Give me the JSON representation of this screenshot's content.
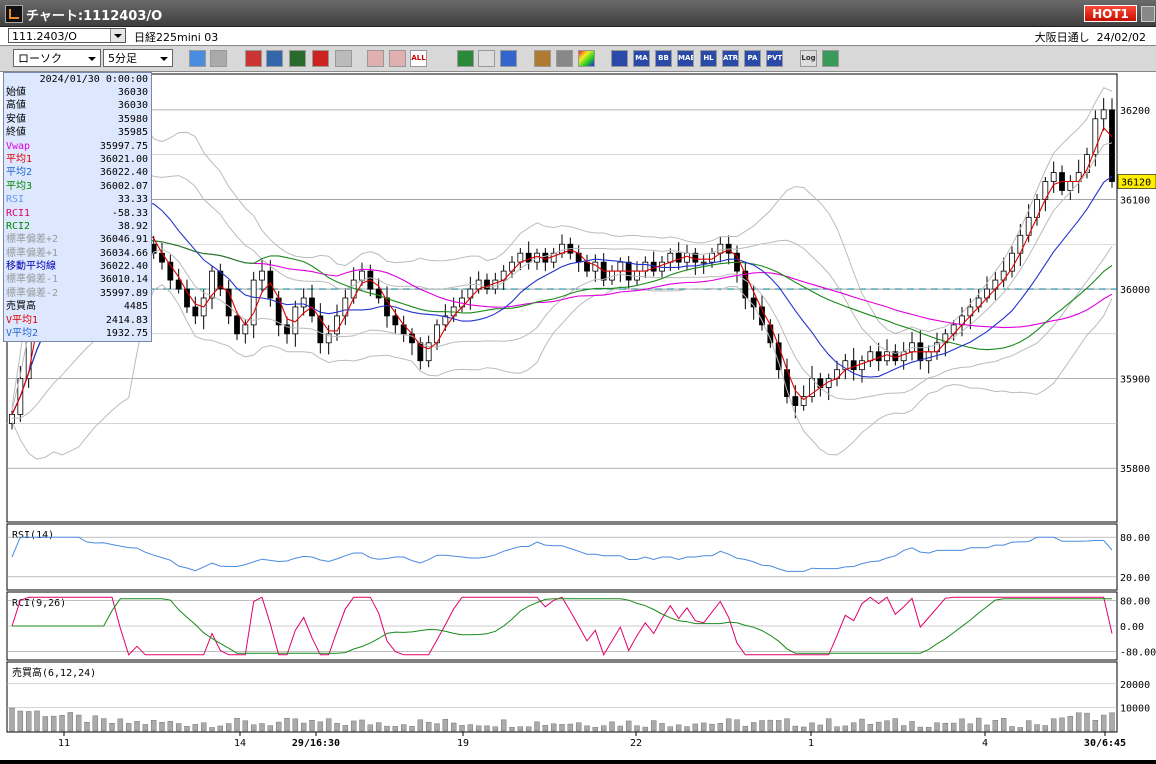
{
  "window": {
    "title": "チャート:1112403/O",
    "hot_label": "HOT1"
  },
  "info": {
    "code": "111.2403/O",
    "name": "日経225mini 03",
    "session": "大阪日通し",
    "date": "24/02/02"
  },
  "toolbar": {
    "chart_type": "ローソク",
    "period": "5分足",
    "icons": [
      "zoom-icon",
      "cursor-line-icon",
      "pointer-icon",
      "help-icon",
      "bar-icon",
      "compare-icon",
      "scale-icon",
      "line-draw-icon",
      "select-icon",
      "undo-icon",
      "grid-icon",
      "wrench-icon",
      "color-icon",
      "ma-icon",
      "bb-icon",
      "mae-icon",
      "hl-icon",
      "atr-icon",
      "para-icon",
      "pvt-icon",
      "log-icon",
      "bookmark-icon"
    ],
    "labels": {
      "ma": "MA",
      "bb": "BB",
      "mae": "MAE",
      "hl": "HL",
      "atr": "ATR",
      "para": "PA RA",
      "pvt": "PVT",
      "log": "Log",
      "all": "ALL"
    }
  },
  "data_panel": {
    "datetime": "2024/01/30 0:00:00",
    "rows": [
      {
        "k": "始値",
        "v": "36030",
        "color": "#000000"
      },
      {
        "k": "高値",
        "v": "36030",
        "color": "#000000"
      },
      {
        "k": "安値",
        "v": "35980",
        "color": "#000000"
      },
      {
        "k": "終値",
        "v": "35985",
        "color": "#000000"
      },
      {
        "k": "Vwap",
        "v": "35997.75",
        "color": "#e000e0"
      },
      {
        "k": "平均1",
        "v": "36021.00",
        "color": "#e00000"
      },
      {
        "k": "平均2",
        "v": "36022.40",
        "color": "#2266cc"
      },
      {
        "k": "平均3",
        "v": "36002.07",
        "color": "#008800"
      },
      {
        "k": "RSI",
        "v": "33.33",
        "color": "#6699ee"
      },
      {
        "k": "RCI1",
        "v": "-58.33",
        "color": "#e0006a"
      },
      {
        "k": "RCI2",
        "v": "38.92",
        "color": "#008800"
      },
      {
        "k": "標準偏差+2",
        "v": "36046.91",
        "color": "#999999"
      },
      {
        "k": "標準偏差+1",
        "v": "36034.66",
        "color": "#999999"
      },
      {
        "k": "移動平均線",
        "v": "36022.40",
        "color": "#0000aa"
      },
      {
        "k": "標準偏差-1",
        "v": "36010.14",
        "color": "#999999"
      },
      {
        "k": "標準偏差-2",
        "v": "35997.89",
        "color": "#999999"
      },
      {
        "k": "売買高",
        "v": "4485",
        "color": "#000000"
      },
      {
        "k": "V平均1",
        "v": "2414.83",
        "color": "#e00000"
      },
      {
        "k": "V平均2",
        "v": "1932.75",
        "color": "#2266cc"
      }
    ]
  },
  "chart_data": [
    {
      "type": "candlestick",
      "title": "",
      "price_ticks": [
        "36200",
        "36100",
        "36000",
        "35900",
        "35800"
      ],
      "current_price": "36120",
      "ylim": [
        35740,
        36240
      ],
      "reference_line": 36000,
      "closes": [
        35860,
        35900,
        35960,
        36010,
        36040,
        36060,
        36120,
        36130,
        36150,
        36110,
        36100,
        36120,
        36100,
        36080,
        36060,
        36080,
        36050,
        36040,
        36030,
        36010,
        36000,
        35980,
        35970,
        35990,
        36020,
        36000,
        35970,
        35950,
        35960,
        36010,
        36020,
        35990,
        35960,
        35950,
        35980,
        35990,
        35970,
        35940,
        35950,
        35970,
        35990,
        36010,
        36020,
        36000,
        35990,
        35970,
        35960,
        35950,
        35940,
        35920,
        35940,
        35960,
        35970,
        35980,
        35990,
        36000,
        36010,
        36000,
        36010,
        36020,
        36030,
        36040,
        36030,
        36040,
        36030,
        36040,
        36050,
        36040,
        36030,
        36020,
        36030,
        36010,
        36020,
        36030,
        36010,
        36020,
        36030,
        36020,
        36030,
        36040,
        36030,
        36040,
        36030,
        36030,
        36040,
        36050,
        36040,
        36020,
        35990,
        35980,
        35960,
        35940,
        35910,
        35880,
        35870,
        35880,
        35900,
        35890,
        35900,
        35910,
        35920,
        35910,
        35920,
        35930,
        35920,
        35930,
        35920,
        35930,
        35940,
        35920,
        35930,
        35940,
        35950,
        35960,
        35970,
        35980,
        35990,
        36000,
        36010,
        36020,
        36040,
        36060,
        36080,
        36100,
        36120,
        36130,
        36110,
        36120,
        36130,
        36150,
        36190,
        36200,
        36120
      ]
    },
    {
      "type": "line",
      "title": "RSI(14)",
      "ticks": [
        "80.00",
        "20.00"
      ],
      "ylim": [
        0,
        100
      ]
    },
    {
      "type": "line",
      "title": "RCI(9,26)",
      "ticks": [
        "80.00",
        "0.00",
        "-80.00"
      ],
      "ylim": [
        -100,
        100
      ]
    },
    {
      "type": "bar",
      "title": "売買高(6,12,24)",
      "ticks": [
        "20000",
        "10000"
      ],
      "ylim": [
        0,
        28000
      ]
    }
  ],
  "x_axis": {
    "labels": [
      "11",
      "14",
      "29/16:30",
      "19",
      "22",
      "1",
      "4",
      "30/6:45"
    ]
  }
}
